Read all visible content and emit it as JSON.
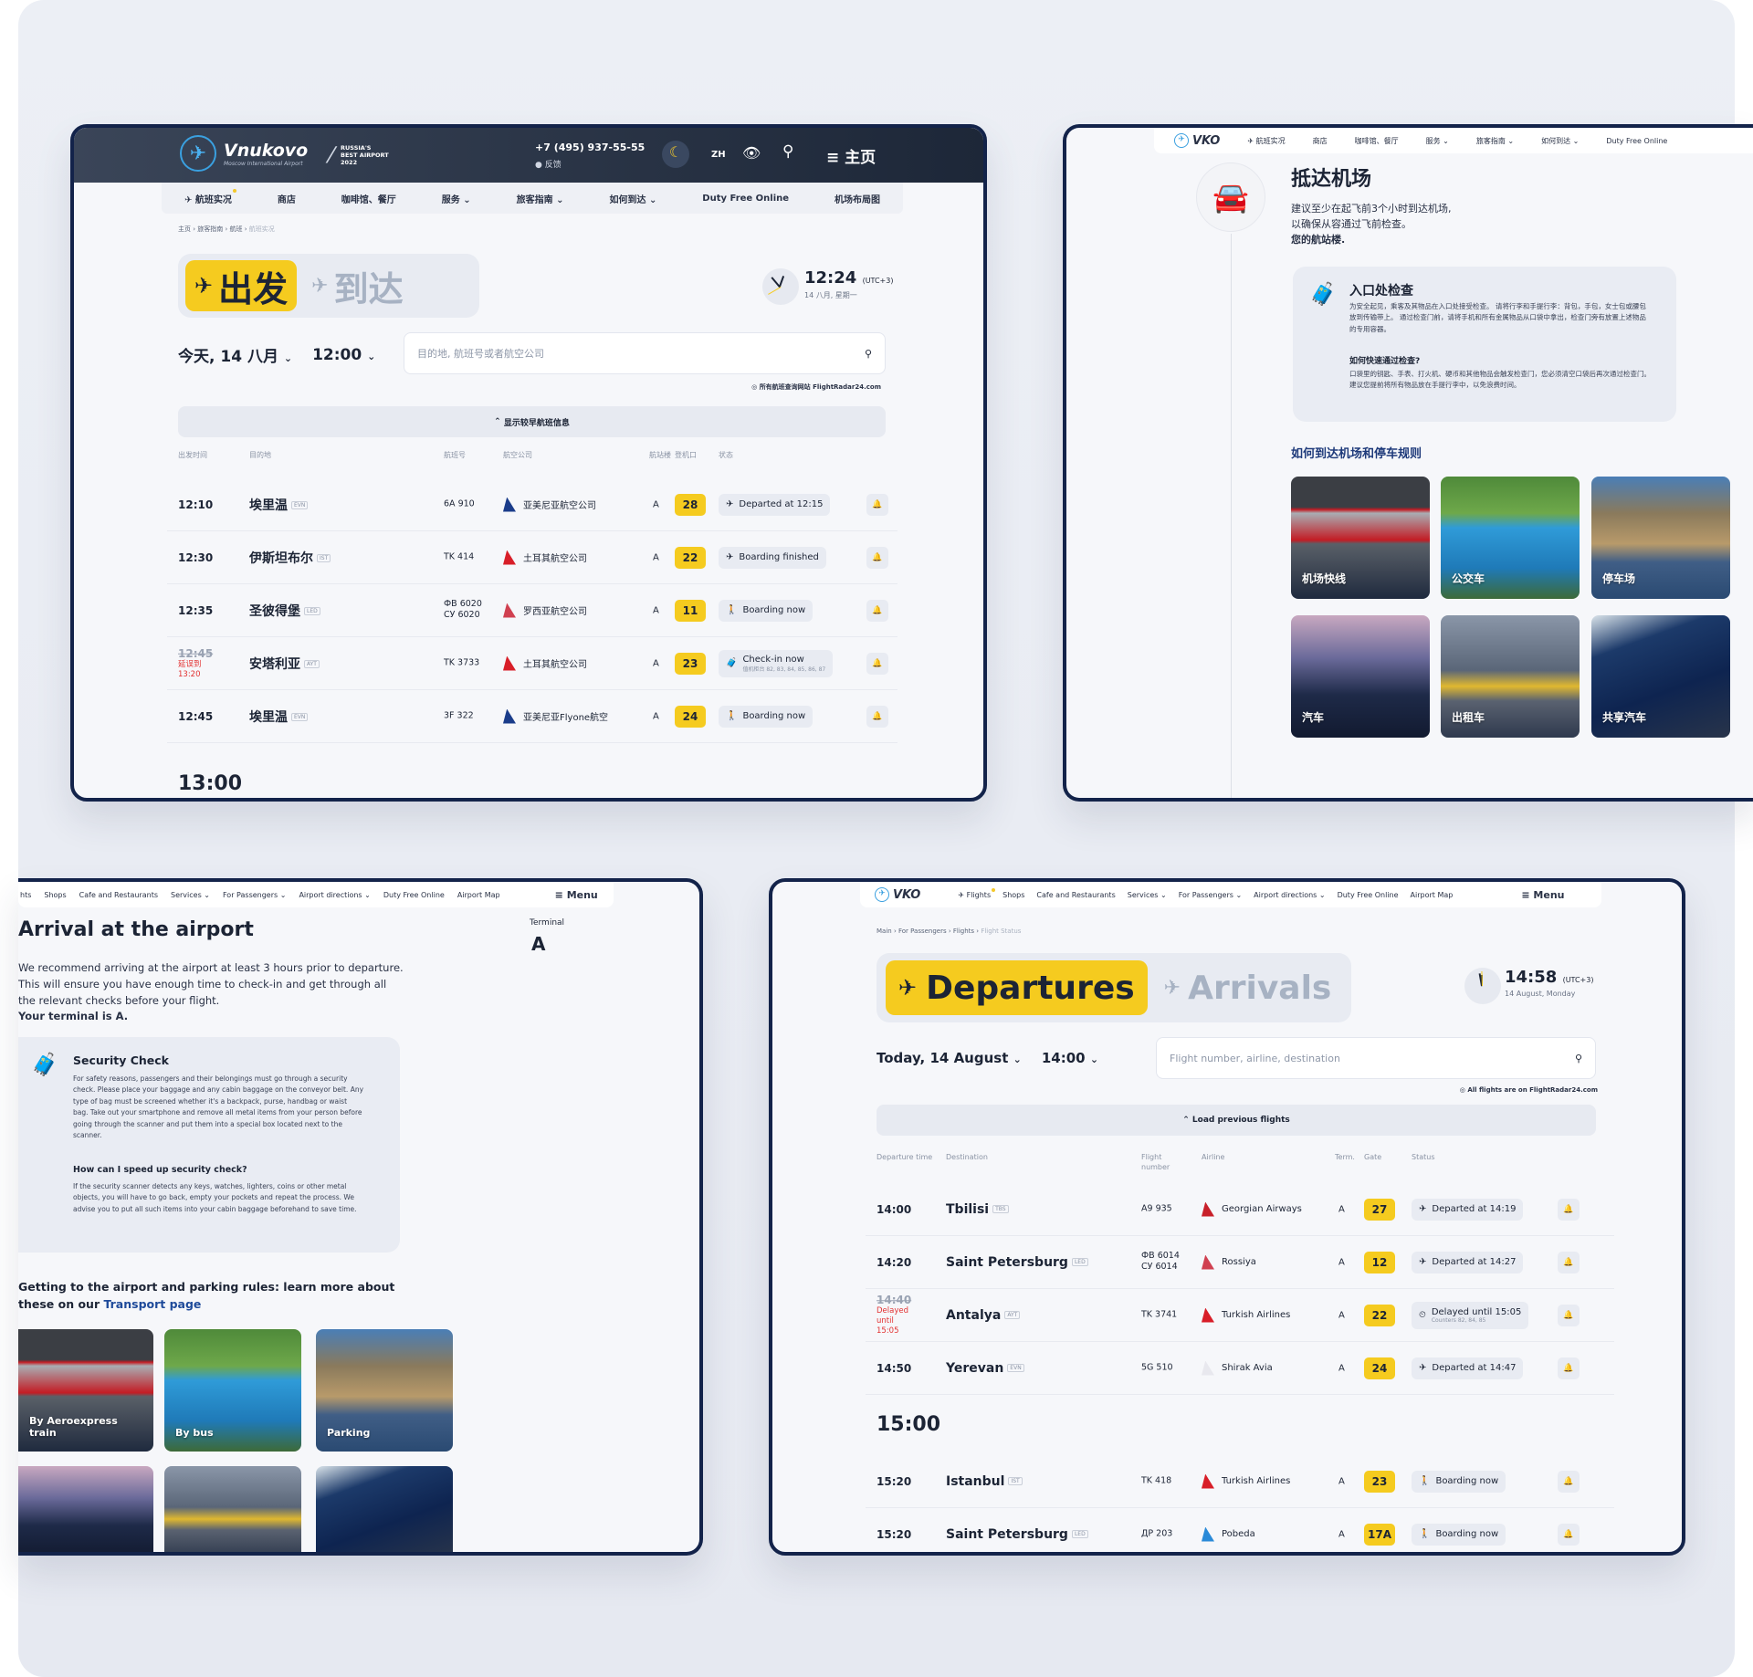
{
  "zh_flights": {
    "logo": {
      "name": "Vnukovo",
      "subtitle": "Moscow International Airport"
    },
    "award": {
      "line1": "RUSSIA'S",
      "line2": "BEST AIRPORT",
      "line3": "2022"
    },
    "phone": "+7 (495) 937-55-55",
    "feedback": "反馈",
    "lang": "ZH",
    "menu_label": "主页",
    "nav": [
      "航班实况",
      "商店",
      "咖啡馆、餐厅",
      "服务",
      "旅客指南",
      "如何到达",
      "Duty Free Online",
      "机场布局图"
    ],
    "breadcrumb": [
      "主页",
      "旅客指南",
      "航班",
      "航班实况"
    ],
    "tab_departures": "出发",
    "tab_arrivals": "到达",
    "clock": {
      "time": "12:24",
      "tz": "(UTC+3)",
      "date": "14 八月, 星期一"
    },
    "date_select": "今天, 14 八月",
    "time_select": "12:00",
    "search_placeholder": "目的地, 航班号或者航空公司",
    "fr24_note": "所有航班查询网站 FlightRadar24.com",
    "load_previous": "显示较早航班信息",
    "columns": {
      "time": "出发时间",
      "dest": "目的地",
      "flight": "航班号",
      "airline": "航空公司",
      "term": "航站楼",
      "gate": "登机口",
      "status": "状态"
    },
    "flights": [
      {
        "time": "12:10",
        "dest": "埃里温",
        "iata": "EVN",
        "flight": "6A 910",
        "flight2": "",
        "airline": "亚美尼亚航空公司",
        "tail": "#1a3c8a",
        "term": "A",
        "gate": "28",
        "status": "Departed at 12:15",
        "status_sub": "",
        "delay": ""
      },
      {
        "time": "12:30",
        "dest": "伊斯坦布尔",
        "iata": "IST",
        "flight": "TK 414",
        "flight2": "",
        "airline": "土耳其航空公司",
        "tail": "#d81e28",
        "term": "A",
        "gate": "22",
        "status": "Boarding finished",
        "status_sub": "",
        "delay": ""
      },
      {
        "time": "12:35",
        "dest": "圣彼得堡",
        "iata": "LED",
        "flight": "ФВ 6020",
        "flight2": "СУ 6020",
        "airline": "罗西亚航空公司",
        "tail": "#d04050",
        "term": "A",
        "gate": "11",
        "status": "Boarding now",
        "status_sub": "",
        "delay": ""
      },
      {
        "time": "12:45",
        "dest": "安塔利亚",
        "iata": "AYT",
        "flight": "TK 3733",
        "flight2": "",
        "airline": "土耳其航空公司",
        "tail": "#d81e28",
        "term": "A",
        "gate": "23",
        "status": "Check-in now",
        "status_sub": "值机柜台 82, 83, 84, 85, 86, 87",
        "delay": "延误到 13:20"
      },
      {
        "time": "12:45",
        "dest": "埃里温",
        "iata": "EVN",
        "flight": "3F 322",
        "flight2": "",
        "airline": "亚美尼亚Flyone航空",
        "tail": "#1a3c8a",
        "term": "A",
        "gate": "24",
        "status": "Boarding now",
        "status_sub": "",
        "delay": ""
      }
    ],
    "next_hour": "13:00"
  },
  "zh_arrival": {
    "logo": "VKO",
    "nav": [
      "航班实况",
      "商店",
      "咖啡馆、餐厅",
      "服务",
      "旅客指南",
      "如何到达",
      "Duty Free Online"
    ],
    "title": "抵达机场",
    "text1": "建议至少在起飞前3个小时到达机场,",
    "text2": "以确保从容通过飞前检查。",
    "text3": "您的航站楼.",
    "card_title": "入口处检查",
    "card_body": "为安全起见，乘客及其物品在入口处接受检查。 请将行李和手提行李：背包，手包，女士包或腰包放到传输带上。 通过检查门前，请将手机和所有金属物品从口袋中拿出，检查门旁有放置上述物品的专用容器。",
    "card_q": "如何快速通过检查?",
    "card_a": "口袋里的钥匙、手表、打火机、硬币和其他物品会触发检查门，您必须清空口袋后再次通过检查门。 建议您提前将所有物品放在手提行李中，以免浪费时间。",
    "transport_heading": "如何到达机场和停车规则",
    "tiles": [
      "机场快线",
      "公交车",
      "停车场",
      "汽车",
      "出租车",
      "共享汽车"
    ]
  },
  "en_arrival": {
    "nav": [
      "hts",
      "Shops",
      "Cafe and Restaurants",
      "Services",
      "For Passengers",
      "Airport directions",
      "Duty Free Online",
      "Airport Map"
    ],
    "menu_label": "Menu",
    "title": "Arrival at the airport",
    "terminal_label": "Terminal",
    "terminal_value": "A",
    "text1": "We recommend arriving at the airport at least 3 hours prior to departure.",
    "text2": "This will ensure you have enough time to check-in and get through all",
    "text3": "the relevant checks before your flight.",
    "text4": "Your terminal is A.",
    "card_title": "Security Check",
    "card_body": "For safety reasons, passengers and their belongings must go through a security check. Please place your baggage and any cabin baggage on the conveyor belt. Any type of bag must be screened whether it's a backpack, purse, handbag or waist bag. Take out your smartphone and remove all metal items from your person before going through the scanner and put them into a special box located next to the scanner.",
    "card_q": "How can I speed up security check?",
    "card_a": "If the security scanner detects any keys, watches, lighters, coins or other metal objects, you will have to go back, empty your pockets and repeat the process. We advise you to put all such items into your cabin baggage beforehand to save time.",
    "transport_text": "Getting to the airport and parking rules: learn more about these on our",
    "transport_link": "Transport page",
    "tiles": [
      "By Aeroexpress train",
      "By bus",
      "Parking"
    ]
  },
  "en_flights": {
    "logo": "VKO",
    "nav": [
      "Flights",
      "Shops",
      "Cafe and Restaurants",
      "Services",
      "For Passengers",
      "Airport directions",
      "Duty Free Online",
      "Airport Map"
    ],
    "menu_label": "Menu",
    "breadcrumb": [
      "Main",
      "For Passengers",
      "Flights",
      "Flight Status"
    ],
    "tab_departures": "Departures",
    "tab_arrivals": "Arrivals",
    "clock": {
      "time": "14:58",
      "tz": "(UTC+3)",
      "date": "14 August, Monday"
    },
    "date_select": "Today, 14 August",
    "time_select": "14:00",
    "search_placeholder": "Flight number, airline, destination",
    "fr24_note": "All flights are on FlightRadar24.com",
    "load_previous": "Load previous flights",
    "columns": {
      "time": "Departure time",
      "dest": "Destination",
      "flight": "Flight number",
      "airline": "Airline",
      "term": "Term.",
      "gate": "Gate",
      "status": "Status"
    },
    "flights": [
      {
        "time": "14:00",
        "dest": "Tbilisi",
        "iata": "TBS",
        "flight": "A9 935",
        "flight2": "",
        "airline": "Georgian Airways",
        "tail": "#c8202a",
        "term": "A",
        "gate": "27",
        "status": "Departed at 14:19",
        "status_sub": "",
        "delay": ""
      },
      {
        "time": "14:20",
        "dest": "Saint Petersburg",
        "iata": "LED",
        "flight": "ФВ 6014",
        "flight2": "СУ 6014",
        "airline": "Rossiya",
        "tail": "#d04050",
        "term": "A",
        "gate": "12",
        "status": "Departed at 14:27",
        "status_sub": "",
        "delay": ""
      },
      {
        "time": "14:40",
        "dest": "Antalya",
        "iata": "AYT",
        "flight": "TK 3741",
        "flight2": "",
        "airline": "Turkish Airlines",
        "tail": "#d81e28",
        "term": "A",
        "gate": "22",
        "status": "Delayed until 15:05",
        "status_sub": "Counters 82, 84, 85",
        "delay": "Delayed until 15:05"
      },
      {
        "time": "14:50",
        "dest": "Yerevan",
        "iata": "EVN",
        "flight": "5G 510",
        "flight2": "",
        "airline": "Shirak Avia",
        "tail": "#e8e8ee",
        "term": "A",
        "gate": "24",
        "status": "Departed at 14:47",
        "status_sub": "",
        "delay": ""
      }
    ],
    "next_hour": "15:00",
    "flights2": [
      {
        "time": "15:20",
        "dest": "Istanbul",
        "iata": "IST",
        "flight": "TK 418",
        "airline": "Turkish Airlines",
        "tail": "#d81e28",
        "term": "A",
        "gate": "23",
        "status": "Boarding now"
      },
      {
        "time": "15:20",
        "dest": "Saint Petersburg",
        "iata": "LED",
        "flight": "ДР 203",
        "airline": "Pobeda",
        "tail": "#2a8ad8",
        "term": "A",
        "gate": "17A",
        "status": "Boarding now"
      }
    ]
  },
  "colors": {
    "accent_yellow": "#f5cb1f",
    "navy": "#13234a",
    "delay_red": "#e23232",
    "link_blue": "#1e4a9a"
  }
}
